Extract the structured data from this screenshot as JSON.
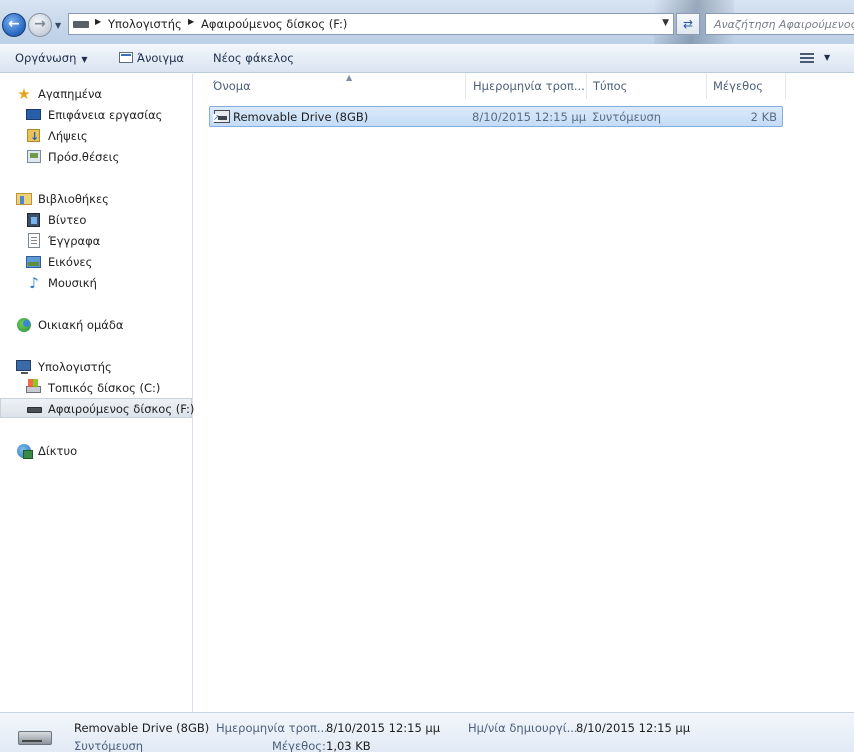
{
  "address": {
    "crumbs": [
      "Υπολογιστής",
      "Αφαιρούμενος δίσκος (F:)"
    ],
    "search_placeholder": "Αναζήτηση Αφαιρούμενος"
  },
  "toolbar": {
    "organize_label": "Οργάνωση",
    "open_label": "Άνοιγμα",
    "new_folder_label": "Νέος φάκελος"
  },
  "nav": {
    "favorites": {
      "label": "Αγαπημένα",
      "items": [
        "Επιφάνεια εργασίας",
        "Λήψεις",
        "Πρόσ.θέσεις"
      ]
    },
    "libraries": {
      "label": "Βιβλιοθήκες",
      "items": [
        "Βίντεο",
        "Έγγραφα",
        "Εικόνες",
        "Μουσική"
      ]
    },
    "homegroup": {
      "label": "Οικιακή ομάδα"
    },
    "computer": {
      "label": "Υπολογιστής",
      "items": [
        "Τοπικός δίσκος (C:)",
        "Αφαιρούμενος δίσκος (F:)"
      ]
    },
    "network": {
      "label": "Δίκτυο"
    }
  },
  "columns": {
    "name": "Όνομα",
    "date": "Ημερομηνία τροπ...",
    "type": "Τύπος",
    "size": "Μέγεθος"
  },
  "files": [
    {
      "name": "Removable Drive (8GB)",
      "date": "8/10/2015 12:15 μμ",
      "type": "Συντόμευση",
      "size": "2 KB"
    }
  ],
  "details": {
    "name": "Removable Drive (8GB)",
    "type": "Συντόμευση",
    "modified_label": "Ημερομηνία τροπ...",
    "modified_value": "8/10/2015 12:15 μμ",
    "size_label": "Μέγεθος:",
    "size_value": "1,03 KB",
    "created_label": "Ημ/νία δημιουργί...",
    "created_value": "8/10/2015 12:15 μμ"
  }
}
